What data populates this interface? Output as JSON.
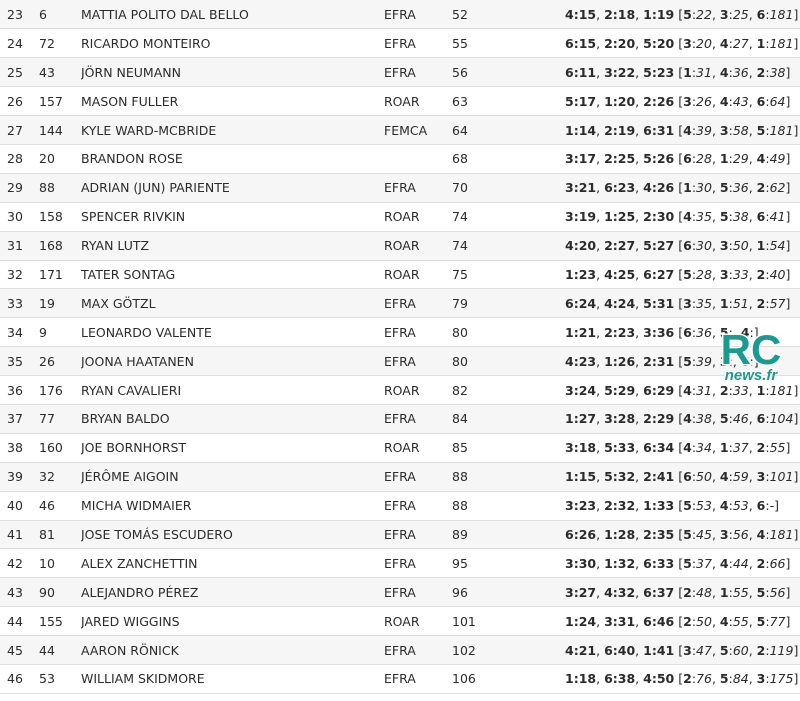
{
  "rows": [
    {
      "pos": "23",
      "num": "6",
      "name": "MATTIA POLITO DAL BELLO",
      "club": "EFRA",
      "points": "52",
      "results": [
        [
          "4",
          "15"
        ],
        [
          "2",
          "18"
        ],
        [
          "1",
          "19"
        ]
      ],
      "drops": [
        [
          "5",
          "22"
        ],
        [
          "3",
          "25"
        ],
        [
          "6",
          "181"
        ]
      ]
    },
    {
      "pos": "24",
      "num": "72",
      "name": "RICARDO MONTEIRO",
      "club": "EFRA",
      "points": "55",
      "results": [
        [
          "6",
          "15"
        ],
        [
          "2",
          "20"
        ],
        [
          "5",
          "20"
        ]
      ],
      "drops": [
        [
          "3",
          "20"
        ],
        [
          "4",
          "27"
        ],
        [
          "1",
          "181"
        ]
      ]
    },
    {
      "pos": "25",
      "num": "43",
      "name": "JÖRN NEUMANN",
      "club": "EFRA",
      "points": "56",
      "results": [
        [
          "6",
          "11"
        ],
        [
          "3",
          "22"
        ],
        [
          "5",
          "23"
        ]
      ],
      "drops": [
        [
          "1",
          "31"
        ],
        [
          "4",
          "36"
        ],
        [
          "2",
          "38"
        ]
      ]
    },
    {
      "pos": "26",
      "num": "157",
      "name": "MASON FULLER",
      "club": "ROAR",
      "points": "63",
      "results": [
        [
          "5",
          "17"
        ],
        [
          "1",
          "20"
        ],
        [
          "2",
          "26"
        ]
      ],
      "drops": [
        [
          "3",
          "26"
        ],
        [
          "4",
          "43"
        ],
        [
          "6",
          "64"
        ]
      ]
    },
    {
      "pos": "27",
      "num": "144",
      "name": "KYLE WARD-MCBRIDE",
      "club": "FEMCA",
      "points": "64",
      "results": [
        [
          "1",
          "14"
        ],
        [
          "2",
          "19"
        ],
        [
          "6",
          "31"
        ]
      ],
      "drops": [
        [
          "4",
          "39"
        ],
        [
          "3",
          "58"
        ],
        [
          "5",
          "181"
        ]
      ]
    },
    {
      "pos": "28",
      "num": "20",
      "name": "BRANDON ROSE",
      "club": "",
      "points": "68",
      "results": [
        [
          "3",
          "17"
        ],
        [
          "2",
          "25"
        ],
        [
          "5",
          "26"
        ]
      ],
      "drops": [
        [
          "6",
          "28"
        ],
        [
          "1",
          "29"
        ],
        [
          "4",
          "49"
        ]
      ]
    },
    {
      "pos": "29",
      "num": "88",
      "name": "ADRIAN (JUN) PARIENTE",
      "club": "EFRA",
      "points": "70",
      "results": [
        [
          "3",
          "21"
        ],
        [
          "6",
          "23"
        ],
        [
          "4",
          "26"
        ]
      ],
      "drops": [
        [
          "1",
          "30"
        ],
        [
          "5",
          "36"
        ],
        [
          "2",
          "62"
        ]
      ]
    },
    {
      "pos": "30",
      "num": "158",
      "name": "SPENCER RIVKIN",
      "club": "ROAR",
      "points": "74",
      "results": [
        [
          "3",
          "19"
        ],
        [
          "1",
          "25"
        ],
        [
          "2",
          "30"
        ]
      ],
      "drops": [
        [
          "4",
          "35"
        ],
        [
          "5",
          "38"
        ],
        [
          "6",
          "41"
        ]
      ]
    },
    {
      "pos": "31",
      "num": "168",
      "name": "RYAN LUTZ",
      "club": "ROAR",
      "points": "74",
      "results": [
        [
          "4",
          "20"
        ],
        [
          "2",
          "27"
        ],
        [
          "5",
          "27"
        ]
      ],
      "drops": [
        [
          "6",
          "30"
        ],
        [
          "3",
          "50"
        ],
        [
          "1",
          "54"
        ]
      ]
    },
    {
      "pos": "32",
      "num": "171",
      "name": "TATER SONTAG",
      "club": "ROAR",
      "points": "75",
      "results": [
        [
          "1",
          "23"
        ],
        [
          "4",
          "25"
        ],
        [
          "6",
          "27"
        ]
      ],
      "drops": [
        [
          "5",
          "28"
        ],
        [
          "3",
          "33"
        ],
        [
          "2",
          "40"
        ]
      ]
    },
    {
      "pos": "33",
      "num": "19",
      "name": "MAX GÖTZL",
      "club": "EFRA",
      "points": "79",
      "results": [
        [
          "6",
          "24"
        ],
        [
          "4",
          "24"
        ],
        [
          "5",
          "31"
        ]
      ],
      "drops": [
        [
          "3",
          "35"
        ],
        [
          "1",
          "51"
        ],
        [
          "2",
          "57"
        ]
      ]
    },
    {
      "pos": "34",
      "num": "9",
      "name": "LEONARDO VALENTE",
      "club": "EFRA",
      "points": "80",
      "results": [
        [
          "1",
          "21"
        ],
        [
          "2",
          "23"
        ],
        [
          "3",
          "36"
        ]
      ],
      "drops": [
        [
          "6",
          "36"
        ],
        [
          "5",
          ""
        ],
        [
          "4",
          ""
        ]
      ]
    },
    {
      "pos": "35",
      "num": "26",
      "name": "JOONA HAATANEN",
      "club": "EFRA",
      "points": "80",
      "results": [
        [
          "4",
          "23"
        ],
        [
          "1",
          "26"
        ],
        [
          "2",
          "31"
        ]
      ],
      "drops": [
        [
          "5",
          "39"
        ],
        [
          "3",
          ""
        ],
        [
          "6",
          ""
        ]
      ]
    },
    {
      "pos": "36",
      "num": "176",
      "name": "RYAN CAVALIERI",
      "club": "ROAR",
      "points": "82",
      "results": [
        [
          "3",
          "24"
        ],
        [
          "5",
          "29"
        ],
        [
          "6",
          "29"
        ]
      ],
      "drops": [
        [
          "4",
          "31"
        ],
        [
          "2",
          "33"
        ],
        [
          "1",
          "181"
        ]
      ]
    },
    {
      "pos": "37",
      "num": "77",
      "name": "BRYAN BALDO",
      "club": "EFRA",
      "points": "84",
      "results": [
        [
          "1",
          "27"
        ],
        [
          "3",
          "28"
        ],
        [
          "2",
          "29"
        ]
      ],
      "drops": [
        [
          "4",
          "38"
        ],
        [
          "5",
          "46"
        ],
        [
          "6",
          "104"
        ]
      ]
    },
    {
      "pos": "38",
      "num": "160",
      "name": "JOE BORNHORST",
      "club": "ROAR",
      "points": "85",
      "results": [
        [
          "3",
          "18"
        ],
        [
          "5",
          "33"
        ],
        [
          "6",
          "34"
        ]
      ],
      "drops": [
        [
          "4",
          "34"
        ],
        [
          "1",
          "37"
        ],
        [
          "2",
          "55"
        ]
      ]
    },
    {
      "pos": "39",
      "num": "32",
      "name": "JÉRÔME AIGOIN",
      "club": "EFRA",
      "points": "88",
      "results": [
        [
          "1",
          "15"
        ],
        [
          "5",
          "32"
        ],
        [
          "2",
          "41"
        ]
      ],
      "drops": [
        [
          "6",
          "50"
        ],
        [
          "4",
          "59"
        ],
        [
          "3",
          "101"
        ]
      ]
    },
    {
      "pos": "40",
      "num": "46",
      "name": "MICHA WIDMAIER",
      "club": "EFRA",
      "points": "88",
      "results": [
        [
          "3",
          "23"
        ],
        [
          "2",
          "32"
        ],
        [
          "1",
          "33"
        ]
      ],
      "drops": [
        [
          "5",
          "53"
        ],
        [
          "4",
          "53"
        ],
        [
          "6",
          "-"
        ]
      ]
    },
    {
      "pos": "41",
      "num": "81",
      "name": "JOSE TOMÁS ESCUDERO",
      "club": "EFRA",
      "points": "89",
      "results": [
        [
          "6",
          "26"
        ],
        [
          "1",
          "28"
        ],
        [
          "2",
          "35"
        ]
      ],
      "drops": [
        [
          "5",
          "45"
        ],
        [
          "3",
          "56"
        ],
        [
          "4",
          "181"
        ]
      ]
    },
    {
      "pos": "42",
      "num": "10",
      "name": "ALEX ZANCHETTIN",
      "club": "EFRA",
      "points": "95",
      "results": [
        [
          "3",
          "30"
        ],
        [
          "1",
          "32"
        ],
        [
          "6",
          "33"
        ]
      ],
      "drops": [
        [
          "5",
          "37"
        ],
        [
          "4",
          "44"
        ],
        [
          "2",
          "66"
        ]
      ]
    },
    {
      "pos": "43",
      "num": "90",
      "name": "ALEJANDRO PÉREZ",
      "club": "EFRA",
      "points": "96",
      "results": [
        [
          "3",
          "27"
        ],
        [
          "4",
          "32"
        ],
        [
          "6",
          "37"
        ]
      ],
      "drops": [
        [
          "2",
          "48"
        ],
        [
          "1",
          "55"
        ],
        [
          "5",
          "56"
        ]
      ]
    },
    {
      "pos": "44",
      "num": "155",
      "name": "JARED WIGGINS",
      "club": "ROAR",
      "points": "101",
      "results": [
        [
          "1",
          "24"
        ],
        [
          "3",
          "31"
        ],
        [
          "6",
          "46"
        ]
      ],
      "drops": [
        [
          "2",
          "50"
        ],
        [
          "4",
          "55"
        ],
        [
          "5",
          "77"
        ]
      ]
    },
    {
      "pos": "45",
      "num": "44",
      "name": "AARON RÖNICK",
      "club": "EFRA",
      "points": "102",
      "results": [
        [
          "4",
          "21"
        ],
        [
          "6",
          "40"
        ],
        [
          "1",
          "41"
        ]
      ],
      "drops": [
        [
          "3",
          "47"
        ],
        [
          "5",
          "60"
        ],
        [
          "2",
          "119"
        ]
      ]
    },
    {
      "pos": "46",
      "num": "53",
      "name": "WILLIAM SKIDMORE",
      "club": "EFRA",
      "points": "106",
      "results": [
        [
          "1",
          "18"
        ],
        [
          "6",
          "38"
        ],
        [
          "4",
          "50"
        ]
      ],
      "drops": [
        [
          "2",
          "76"
        ],
        [
          "5",
          "84"
        ],
        [
          "3",
          "175"
        ]
      ]
    }
  ],
  "watermark": {
    "big": "RC",
    "small": "news.fr",
    "color": "#1a9a90"
  }
}
